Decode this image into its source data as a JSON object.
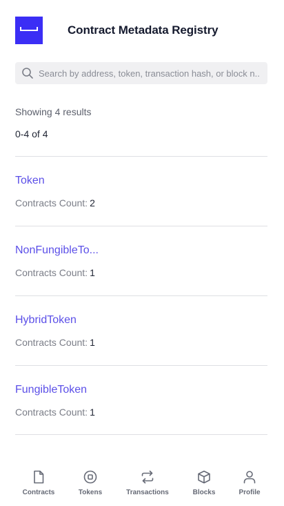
{
  "header": {
    "title": "Contract Metadata Registry"
  },
  "search": {
    "placeholder": "Search by address, token, transaction hash, or block n..."
  },
  "results": {
    "summary": "Showing 4 results",
    "range": "0-4 of 4"
  },
  "items": [
    {
      "name": "Token",
      "count_label": "Contracts Count:",
      "count": "2"
    },
    {
      "name": "NonFungibleTo...",
      "count_label": "Contracts Count:",
      "count": "1"
    },
    {
      "name": "HybridToken",
      "count_label": "Contracts Count:",
      "count": "1"
    },
    {
      "name": "FungibleToken",
      "count_label": "Contracts Count:",
      "count": "1"
    }
  ],
  "nav": [
    {
      "label": "Contracts",
      "icon": "file-icon"
    },
    {
      "label": "Tokens",
      "icon": "token-icon"
    },
    {
      "label": "Transactions",
      "icon": "swap-icon"
    },
    {
      "label": "Blocks",
      "icon": "cube-icon"
    },
    {
      "label": "Profile",
      "icon": "user-icon"
    }
  ],
  "colors": {
    "brand": "#3b2ef5",
    "link": "#5b4fe8"
  }
}
